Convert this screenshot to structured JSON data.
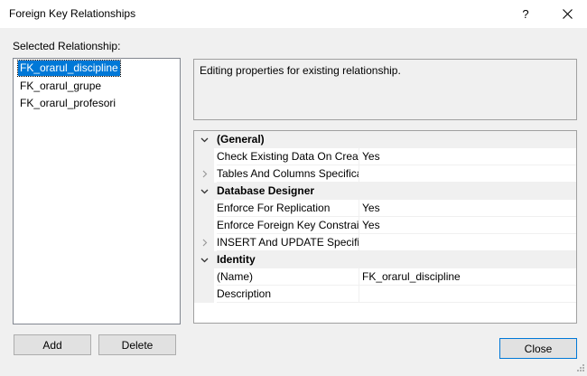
{
  "window": {
    "title": "Foreign Key Relationships",
    "help_glyph": "?"
  },
  "selected_relationship_label": "Selected Relationship:",
  "relationships": [
    {
      "label": "FK_orarul_discipline",
      "selected": true
    },
    {
      "label": "FK_orarul_grupe",
      "selected": false
    },
    {
      "label": "FK_orarul_profesori",
      "selected": false
    }
  ],
  "description": "Editing properties for existing relationship.",
  "properties": [
    {
      "kind": "category",
      "label": "(General)",
      "expander": "chevron-down-icon"
    },
    {
      "kind": "prop",
      "name": "Check Existing Data On Creati",
      "value": "Yes",
      "expander": ""
    },
    {
      "kind": "prop",
      "name": "Tables And Columns Specificati",
      "value": "",
      "expander": "chevron-right-icon"
    },
    {
      "kind": "category",
      "label": "Database Designer",
      "expander": "chevron-down-icon"
    },
    {
      "kind": "prop",
      "name": "Enforce For Replication",
      "value": "Yes",
      "expander": ""
    },
    {
      "kind": "prop",
      "name": "Enforce Foreign Key Constrain",
      "value": "Yes",
      "expander": ""
    },
    {
      "kind": "prop",
      "name": "INSERT And UPDATE Specifica",
      "value": "",
      "expander": "chevron-right-icon"
    },
    {
      "kind": "category",
      "label": "Identity",
      "expander": "chevron-down-icon"
    },
    {
      "kind": "prop",
      "name": "(Name)",
      "value": "FK_orarul_discipline",
      "expander": ""
    },
    {
      "kind": "prop",
      "name": "Description",
      "value": "",
      "expander": ""
    }
  ],
  "buttons": {
    "add": "Add",
    "delete": "Delete",
    "close": "Close"
  },
  "colors": {
    "selection": "#0078d7",
    "dialog_bg": "#f0f0f0"
  }
}
